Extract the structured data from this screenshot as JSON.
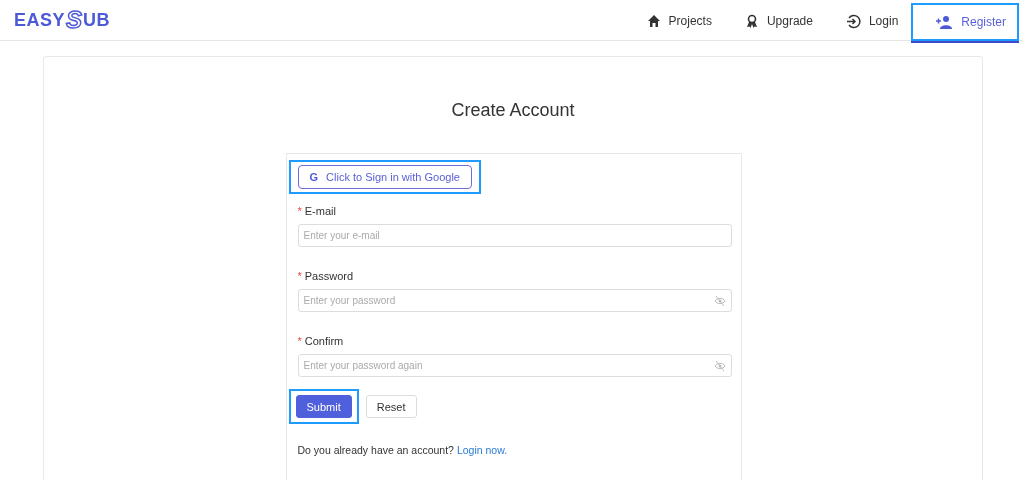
{
  "logo": {
    "parts": [
      "EASY",
      "S",
      "UB"
    ]
  },
  "nav": [
    {
      "label": "Projects",
      "selected": false,
      "highlighted": false
    },
    {
      "label": "Upgrade",
      "selected": false,
      "highlighted": false
    },
    {
      "label": "Login",
      "selected": false,
      "highlighted": false
    },
    {
      "label": "Register",
      "selected": true,
      "highlighted": true
    }
  ],
  "title": "Create Account",
  "google_button": {
    "label": "Click to Sign in with Google",
    "glyph": "G",
    "highlighted": true
  },
  "fields": [
    {
      "label": "E-mail",
      "required_mark": "*",
      "placeholder": "Enter your e-mail",
      "kind": "text"
    },
    {
      "label": "Password",
      "required_mark": "*",
      "placeholder": "Enter your password",
      "kind": "password"
    },
    {
      "label": "Confirm",
      "required_mark": "*",
      "placeholder": "Enter your password again",
      "kind": "password"
    }
  ],
  "buttons": [
    {
      "label": "Submit",
      "kind": "primary",
      "highlighted": true
    },
    {
      "label": "Reset",
      "kind": "default",
      "highlighted": false
    }
  ],
  "footer": {
    "text": "Do you already have an account?",
    "link": "Login now."
  }
}
